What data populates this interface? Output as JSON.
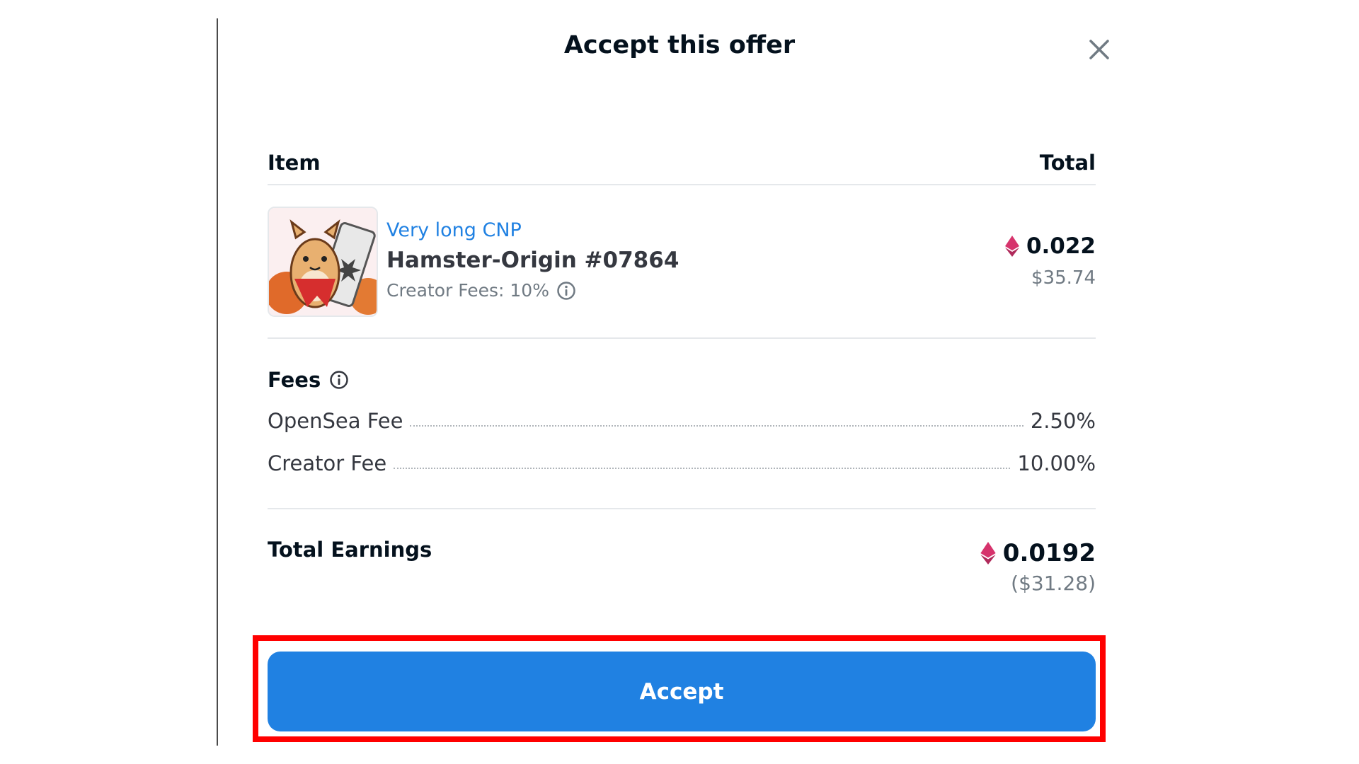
{
  "modal": {
    "title": "Accept this offer"
  },
  "table": {
    "col_item": "Item",
    "col_total": "Total"
  },
  "item": {
    "collection": "Very long CNP",
    "name": "Hamster-Origin #07864",
    "creator_fees": "Creator Fees: 10%",
    "price_eth": "0.022",
    "price_usd": "$35.74"
  },
  "fees": {
    "title": "Fees",
    "rows": [
      {
        "label": "OpenSea Fee",
        "value": "2.50%"
      },
      {
        "label": "Creator Fee",
        "value": "10.00%"
      }
    ]
  },
  "earnings": {
    "label": "Total Earnings",
    "eth": "0.0192",
    "usd": "($31.28)"
  },
  "actions": {
    "accept_label": "Accept"
  },
  "colors": {
    "accent": "#2081e2",
    "eth_icon": "#d6336c",
    "highlight": "#ff0000"
  },
  "icons": {
    "close": "close-icon",
    "info": "info-icon",
    "eth": "ethereum-icon"
  }
}
